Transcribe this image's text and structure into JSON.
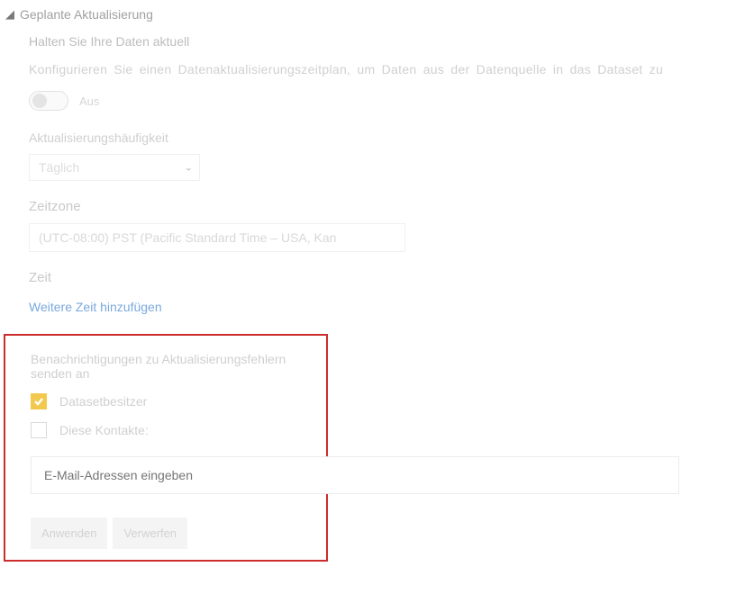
{
  "section": {
    "title": "Geplante Aktualisierung",
    "subtitle": "Halten Sie Ihre Daten aktuell",
    "description": "Konfigurieren Sie einen Datenaktualisierungszeitplan, um Daten aus der Datenquelle in das Dataset zu"
  },
  "toggle": {
    "state_label": "Aus"
  },
  "frequency": {
    "label": "Aktualisierungshäufigkeit",
    "value": "Täglich"
  },
  "timezone": {
    "label": "Zeitzone",
    "value": "(UTC-08:00) PST (Pacific Standard Time – USA, Kan"
  },
  "time": {
    "label": "Zeit",
    "add_link": "Weitere Zeit hinzufügen"
  },
  "notify": {
    "label": "Benachrichtigungen zu Aktualisierungsfehlern senden an",
    "owner_label": "Datasetbesitzer",
    "contacts_label": "Diese Kontakte:",
    "email_placeholder": "E-Mail-Adressen eingeben"
  },
  "buttons": {
    "apply": "Anwenden",
    "discard": "Verwerfen"
  }
}
